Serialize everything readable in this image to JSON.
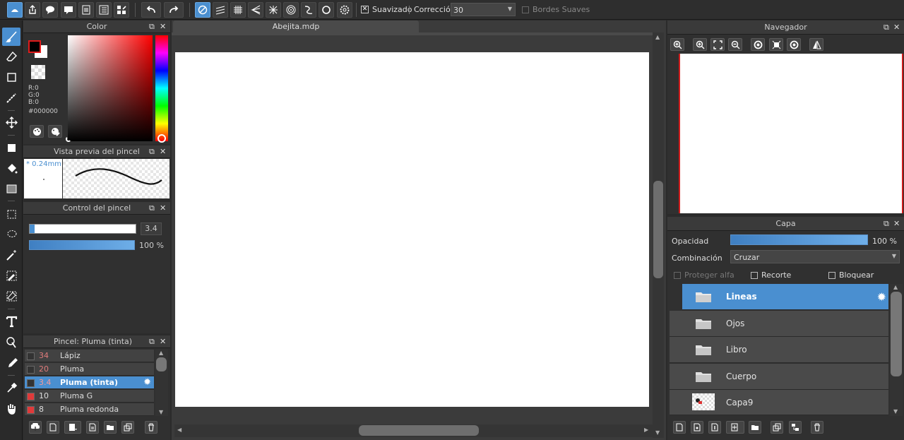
{
  "toolbar": {
    "smoothing_label": "Suavizado",
    "correction_label": "Corrección",
    "correction_value": "30",
    "soft_edges_label": "Bordes Suaves"
  },
  "color_panel": {
    "title": "Color",
    "r": "R:0",
    "g": "G:0",
    "b": "B:0",
    "hex": "#000000",
    "fg_color": "#000000",
    "bg_color": "#ffffff"
  },
  "brush_preview": {
    "title": "Vista previa del pincel",
    "size": "* 0.24mm"
  },
  "brush_control": {
    "title": "Control del pincel",
    "size_value": "3.4",
    "opacity_value": "100 %"
  },
  "brush_list": {
    "title": "Pincel: Pluma (tinta)",
    "items": [
      {
        "size": "34",
        "name": "Lápiz",
        "swatch": "#333333"
      },
      {
        "size": "20",
        "name": "Pluma",
        "swatch": "#333333"
      },
      {
        "size": "3.4",
        "name": "Pluma (tinta)",
        "swatch": "#333333"
      },
      {
        "size": "10",
        "name": "Pluma G",
        "swatch": "#e03a3a"
      },
      {
        "size": "8",
        "name": "Pluma redonda",
        "swatch": "#e03a3a"
      }
    ]
  },
  "canvas": {
    "tab_title": "Abejita.mdp"
  },
  "navigator": {
    "title": "Navegador"
  },
  "layers": {
    "title": "Capa",
    "opacity_label": "Opacidad",
    "opacity_value": "100 %",
    "blend_label": "Combinación",
    "blend_value": "Cruzar",
    "protect_alpha": "Proteger alfa",
    "clipping": "Recorte",
    "lock": "Bloquear",
    "items": [
      {
        "name": "Lineas",
        "type": "folder"
      },
      {
        "name": "Ojos",
        "type": "folder"
      },
      {
        "name": "Libro",
        "type": "folder"
      },
      {
        "name": "Cuerpo",
        "type": "folder"
      },
      {
        "name": "Capa9",
        "type": "layer"
      }
    ]
  },
  "colors": {
    "accent": "#4a8fd0",
    "panel": "#303030",
    "background": "#2b2b2b"
  }
}
